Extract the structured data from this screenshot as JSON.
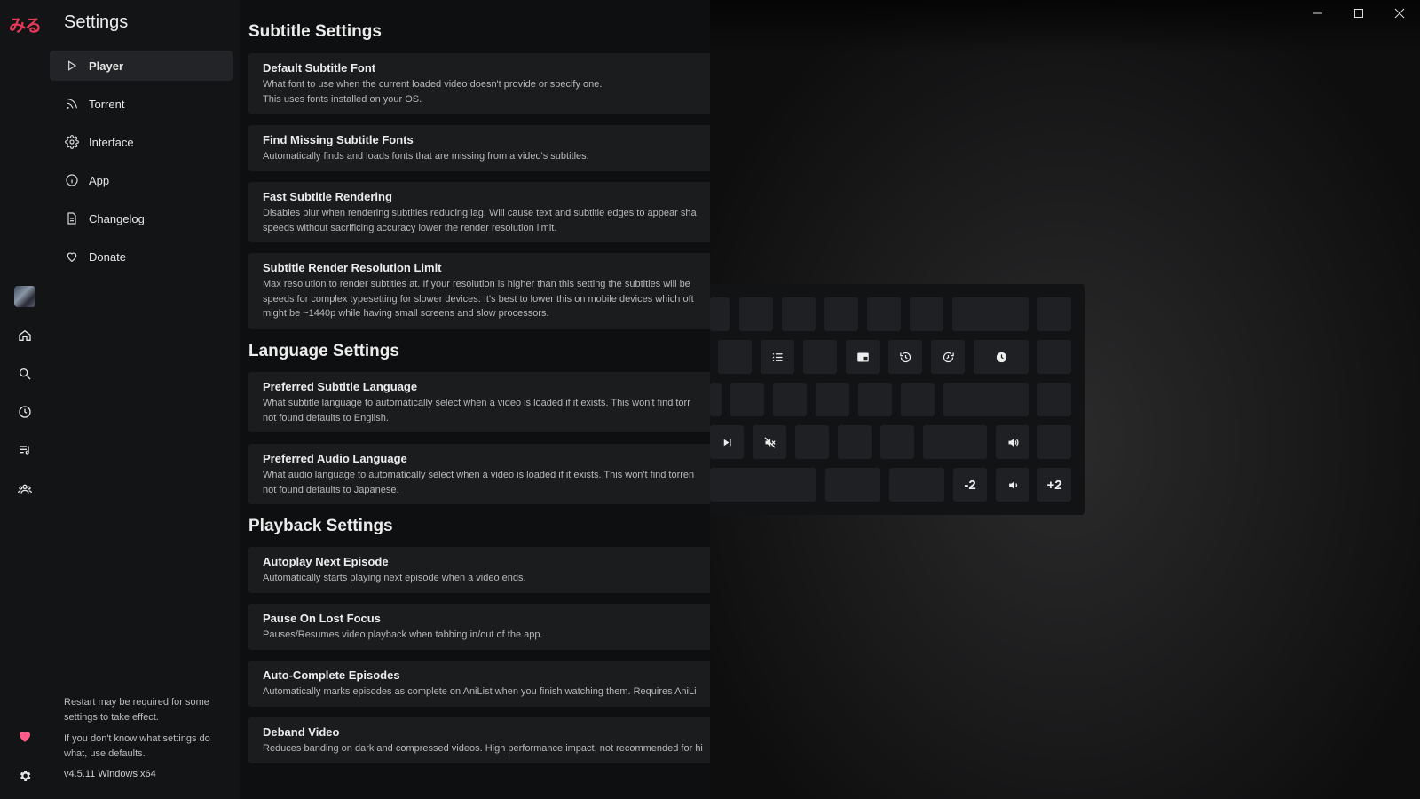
{
  "app": {
    "logo": "みる",
    "settings_title": "Settings"
  },
  "nav": [
    {
      "label": "Player",
      "icon": "play-icon",
      "active": true
    },
    {
      "label": "Torrent",
      "icon": "rss-icon"
    },
    {
      "label": "Interface",
      "icon": "gear-icon"
    },
    {
      "label": "App",
      "icon": "info-icon"
    },
    {
      "label": "Changelog",
      "icon": "document-icon"
    },
    {
      "label": "Donate",
      "icon": "heart-icon"
    }
  ],
  "notes": {
    "restart": "Restart may be required for some settings to take effect.",
    "defaults": "If you don't know what settings do what, use defaults.",
    "version": "v4.5.11 Windows x64"
  },
  "sections": {
    "subtitle": "Subtitle Settings",
    "language": "Language Settings",
    "playback": "Playback Settings"
  },
  "cards": [
    {
      "title": "Default Subtitle Font",
      "desc": "What font to use when the current loaded video doesn't provide or specify one.\nThis uses fonts installed on your OS."
    },
    {
      "title": "Find Missing Subtitle Fonts",
      "desc": "Automatically finds and loads fonts that are missing from a video's subtitles."
    },
    {
      "title": "Fast Subtitle Rendering",
      "desc": "Disables blur when rendering subtitles reducing lag. Will cause text and subtitle edges to appear sha\nspeeds without sacrificing accuracy lower the render resolution limit."
    },
    {
      "title": "Subtitle Render Resolution Limit",
      "desc": "Max resolution to render subtitles at. If your resolution is higher than this setting the subtitles will be\nspeeds for complex typesetting for slower devices. It's best to lower this on mobile devices which oft\nmight be ~1440p while having small screens and slow processors."
    },
    {
      "title": "Preferred Subtitle Language",
      "desc": "What subtitle language to automatically select when a video is loaded if it exists. This won't find torr\nnot found defaults to English."
    },
    {
      "title": "Preferred Audio Language",
      "desc": "What audio language to automatically select when a video is loaded if it exists. This won't find torren\nnot found defaults to Japanese."
    },
    {
      "title": "Autoplay Next Episode",
      "desc": "Automatically starts playing next episode when a video ends."
    },
    {
      "title": "Pause On Lost Focus",
      "desc": "Pauses/Resumes video playback when tabbing in/out of the app."
    },
    {
      "title": "Auto-Complete Episodes",
      "desc": "Automatically marks episodes as complete on AniList when you finish watching them. Requires AniLi"
    },
    {
      "title": "Deband Video",
      "desc": "Reduces banding on dark and compressed videos. High performance impact, not recommended for hi"
    }
  ],
  "keybinds": {
    "minus": "-2",
    "plus": "+2"
  },
  "colors": {
    "accent": "#e6395a",
    "heart": "#ff5c8a"
  }
}
